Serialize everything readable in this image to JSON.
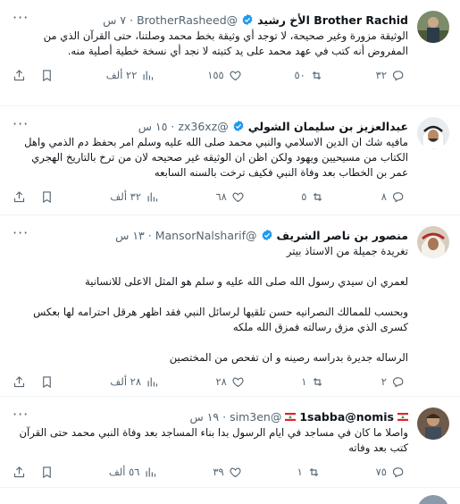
{
  "tweets": [
    {
      "name": "Brother Rachid الأخ رشيد",
      "handle": "@BrotherRasheed",
      "time": "٧ س",
      "verified": true,
      "text": "الوثيقة مزورة وغير صحيحة، لا توجد أي وثيقة بخط محمد وصلتنا، حتى القرآن الذي من المفروض أنه كتب في عهد محمد على يد كتبته لا نجد أي نسخة خطية أصلية منه.",
      "replies": "٣٢",
      "retweets": "٥٠",
      "likes": "١٥٥",
      "views": "٢٢ ألف"
    },
    {
      "name": "عبدالعزيز بن سليمان الشولي",
      "handle": "@zx36xz",
      "time": "١٥ س",
      "verified": true,
      "text": "مافيه شك ان الدين الاسلامي والنبي محمد صلى الله عليه وسلم امر بحفظ دم الذمي واهل الكتاب من مسيحيين ويهود ولكن اظن ان الوثيقه غير صحيحه لان من ترخ بالتاريخ الهجري عمر بن الخطاب بعد وفاة النبي فكيف ترخت بالسنه السابعه",
      "replies": "٨",
      "retweets": "٥",
      "likes": "٦٨",
      "views": "٣٢ ألف"
    },
    {
      "name": "منصور بن ناصر الشريف",
      "handle": "@MansorNalsharif",
      "time": "١٣ س",
      "verified": true,
      "text": "تغريدة جميلة من الاستاذ بيتر\n\nلعمري ان سيدي رسول الله صلى الله عليه و سلم هو المثل الاعلى للانسانية\n\nوبحسب للممالك النصرانيه حسن تلقيها لرسائل النبي فقد اظهر هرقل احترامه لها بعكس كسرى الذي مزق رسالته فمزق الله ملكه\n\nالرساله جديرة بدراسه رصينه و ان تفحص من المختصين",
      "replies": "٢",
      "retweets": "١",
      "likes": "٢٨",
      "views": "٢٨ ألف"
    },
    {
      "name": "1sabba@nomis",
      "handle": "@sim3en",
      "time": "١٩ س",
      "verified": false,
      "text": "واصلا ما كان في مساجد في ايام الرسول بدا بناء المساجد بعد وفاة النبي محمد حتى القرآن كتب بعد وفاته",
      "replies": "٧٥",
      "retweets": "١",
      "likes": "٣٩",
      "views": "٥٦ ألف"
    },
    {
      "name": "",
      "handle": "",
      "time": "",
      "verified": false,
      "text": "",
      "replies": "",
      "retweets": "",
      "likes": "",
      "views": ""
    }
  ],
  "colors": {
    "verified": "#1d9bf0",
    "muted": "#536471",
    "text": "#0f1419",
    "divider": "#eff3f4"
  },
  "icons": [
    "reply-icon",
    "retweet-icon",
    "like-icon",
    "views-icon",
    "bookmark-icon",
    "share-icon",
    "more-icon",
    "verified-badge-icon",
    "lebanon-flag-icon"
  ]
}
